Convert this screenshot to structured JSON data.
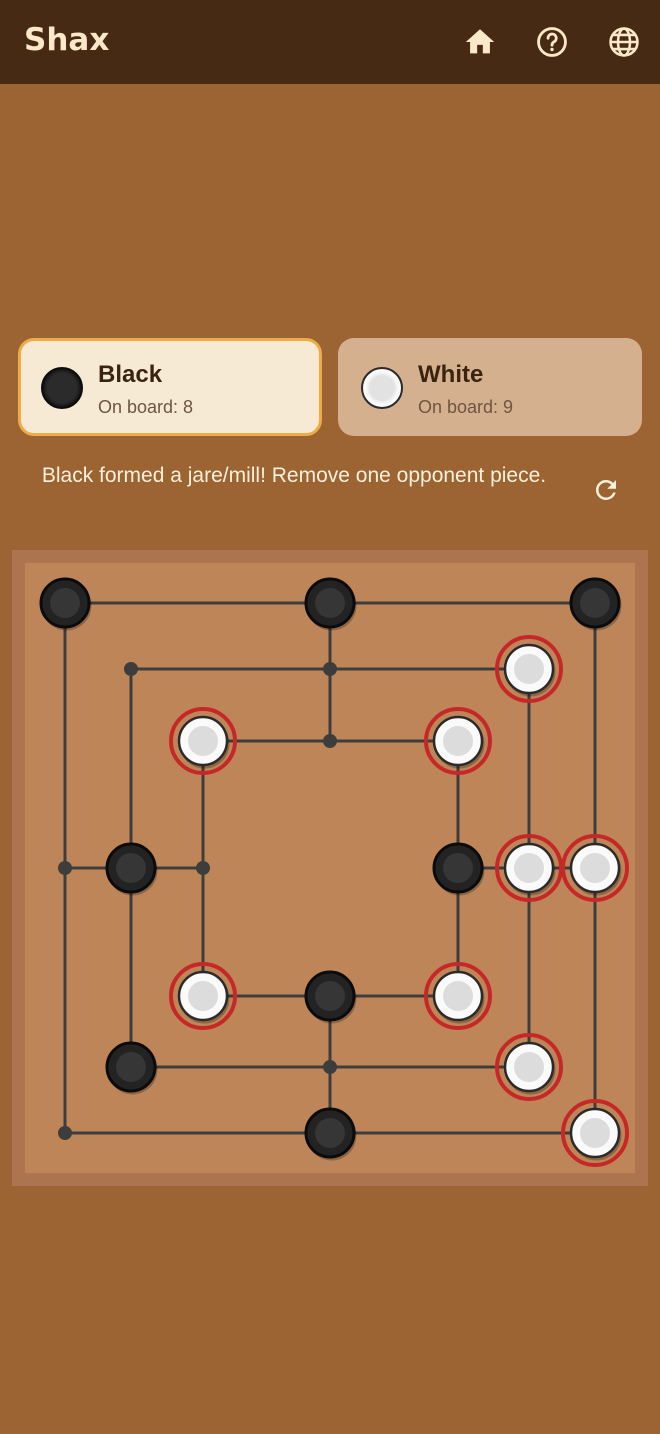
{
  "app": {
    "title": "Shax",
    "icons": [
      "home-icon",
      "help-icon",
      "language-icon"
    ]
  },
  "players": {
    "black": {
      "name": "Black",
      "count_text": "On board: 8",
      "active": true
    },
    "white": {
      "name": "White",
      "count_text": "On board: 9",
      "active": false
    }
  },
  "status": {
    "message": "Black formed a jare/mill! Remove one opponent piece.",
    "restart_icon": "refresh-icon"
  },
  "colors": {
    "appbar": "#472a14",
    "background": "#9c6432",
    "board": "#be8658",
    "board_frame": "#ad7450",
    "active_card": "#f6ead4",
    "active_border": "#eeab47",
    "inactive_card": "#d4b08f",
    "removable_ring": "#c62828"
  },
  "board": {
    "grid": "3 concentric squares, 24 points, lines include diagonals",
    "pieces": [
      {
        "point": "outer-top-left",
        "color": "black"
      },
      {
        "point": "outer-top-middle",
        "color": "black"
      },
      {
        "point": "outer-top-right",
        "color": "black"
      },
      {
        "point": "middle-top-right",
        "color": "white",
        "removable": true
      },
      {
        "point": "inner-top-left",
        "color": "white",
        "removable": true
      },
      {
        "point": "inner-top-right",
        "color": "white",
        "removable": true
      },
      {
        "point": "middle-middle-left",
        "color": "black"
      },
      {
        "point": "inner-middle-right",
        "color": "black"
      },
      {
        "point": "middle-middle-right",
        "color": "white",
        "removable": true
      },
      {
        "point": "outer-middle-right",
        "color": "white",
        "removable": true
      },
      {
        "point": "inner-bottom-left",
        "color": "white",
        "removable": true
      },
      {
        "point": "inner-bottom-middle",
        "color": "black"
      },
      {
        "point": "inner-bottom-right",
        "color": "white",
        "removable": true
      },
      {
        "point": "middle-bottom-left",
        "color": "black"
      },
      {
        "point": "middle-bottom-right",
        "color": "white",
        "removable": true
      },
      {
        "point": "outer-bottom-middle",
        "color": "black"
      },
      {
        "point": "outer-bottom-right",
        "color": "white",
        "removable": true
      }
    ]
  }
}
